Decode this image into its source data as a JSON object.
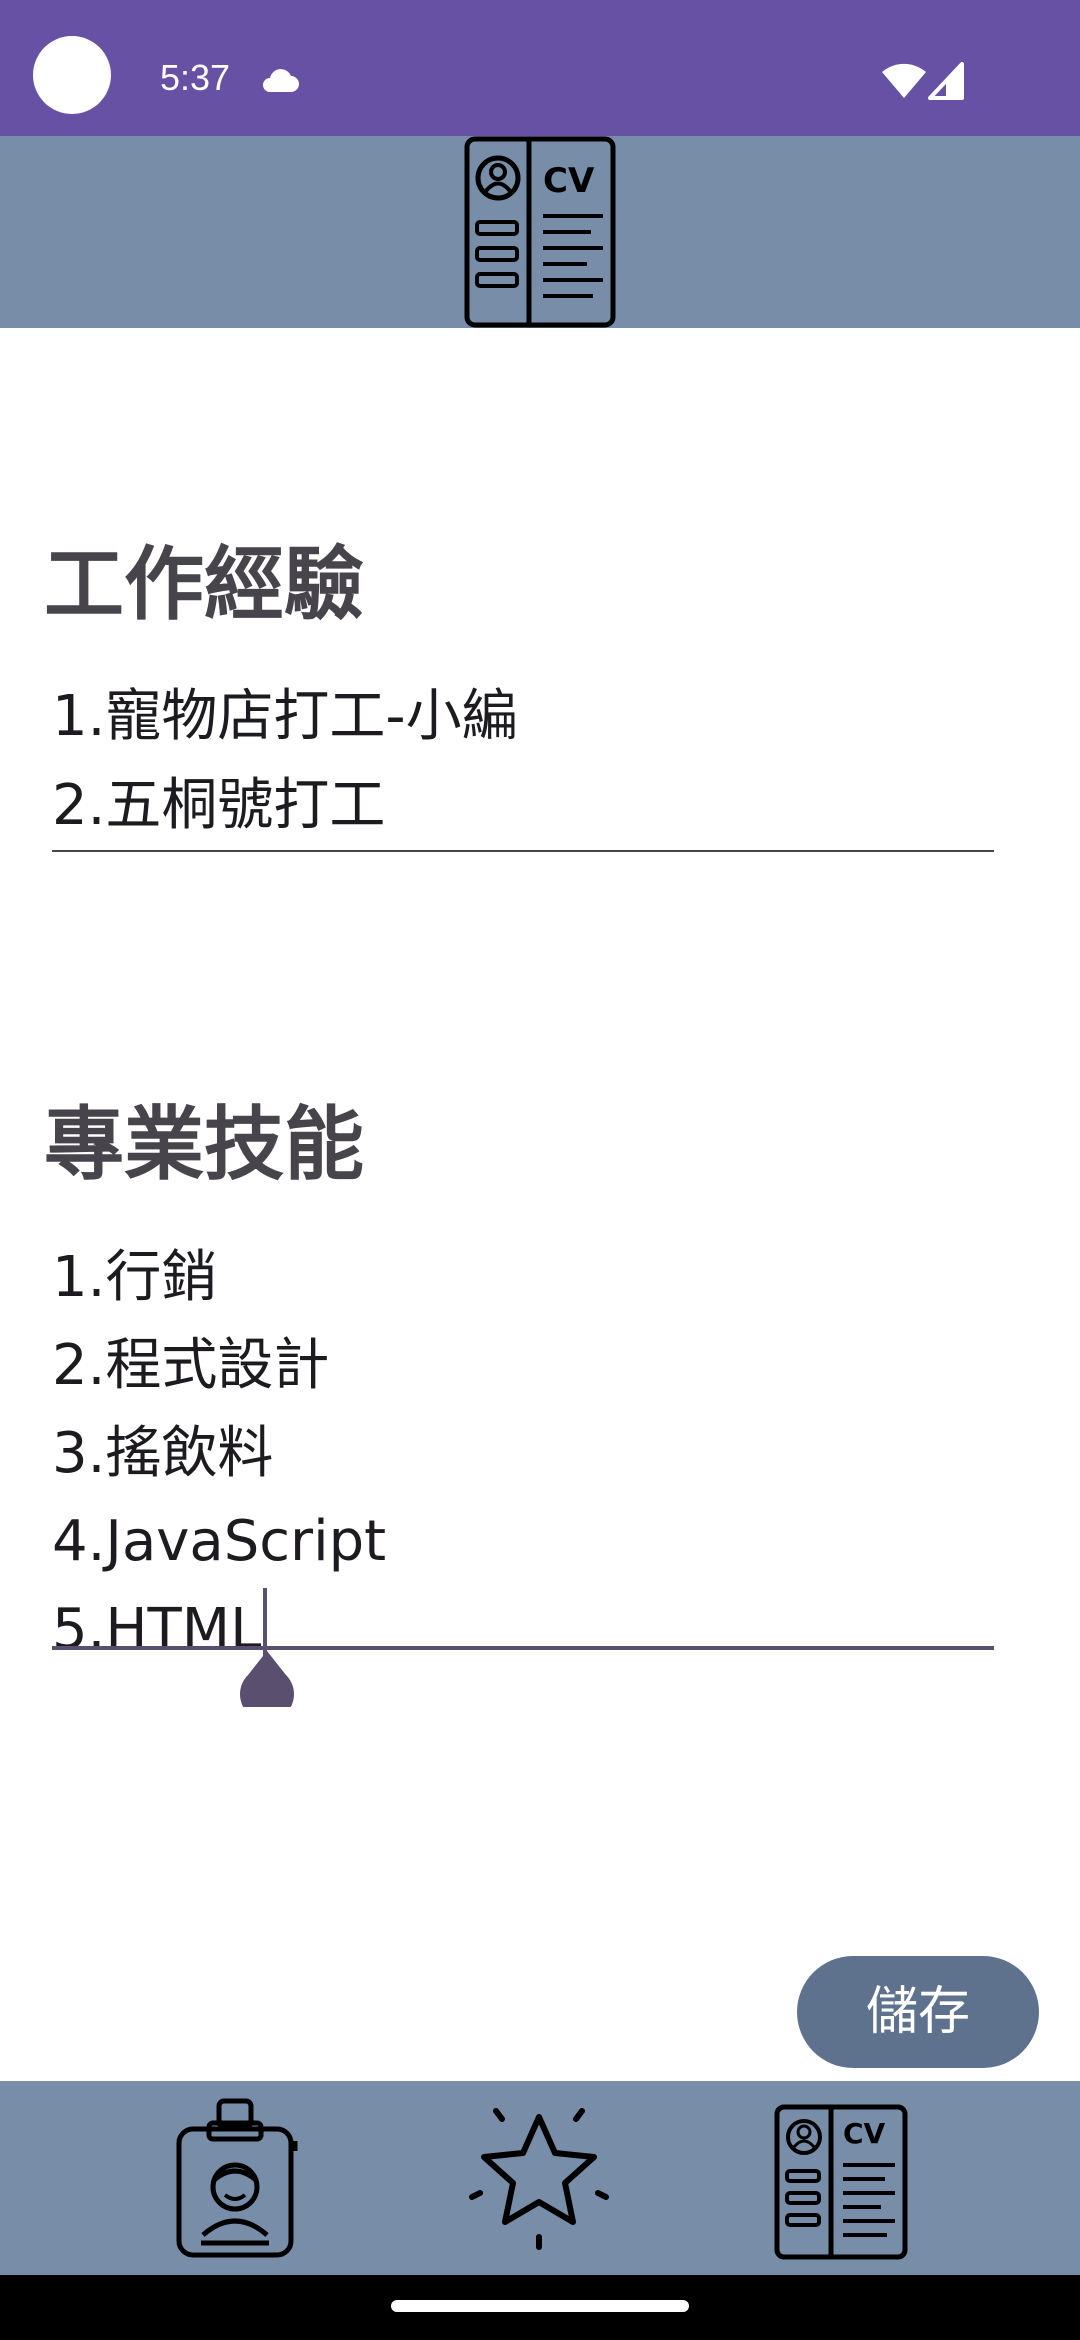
{
  "status_bar": {
    "time": "5:37",
    "icons": [
      "cloud-icon",
      "wifi-icon",
      "cellular-signal-icon"
    ]
  },
  "top_bar": {
    "logo_icon": "cv-resume-icon",
    "logo_text": "CV"
  },
  "work_experience": {
    "title": "工作經驗",
    "text": "1.寵物店打工-小編\n2.五桐號打工"
  },
  "skills": {
    "title": "專業技能",
    "text": "1.行銷\n2.程式設計\n3.搖飲料\n4.JavaScript\n5.HTML"
  },
  "save_button": {
    "label": "儲存"
  },
  "bottom_nav": {
    "items": [
      {
        "icon": "id-badge-icon"
      },
      {
        "icon": "star-icon"
      },
      {
        "icon": "cv-resume-icon",
        "text": "CV"
      }
    ]
  },
  "colors": {
    "status_bar": "#6751a4",
    "app_bar": "#788da8",
    "button": "#5f728d",
    "title_text": "#47444c"
  }
}
